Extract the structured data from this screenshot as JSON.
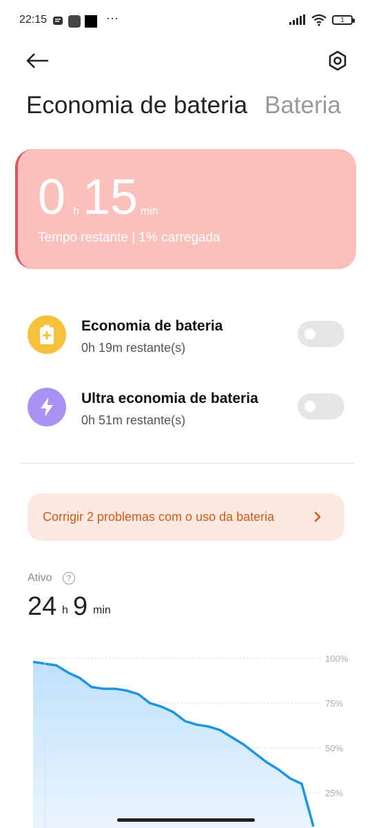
{
  "status_bar": {
    "time": "22:15",
    "battery_level": "1"
  },
  "header": {
    "tab_active": "Economia de bateria",
    "tab_inactive": "Bateria"
  },
  "card": {
    "hours": "0",
    "hours_unit": "h",
    "minutes": "15",
    "minutes_unit": "min",
    "subtitle": "Tempo restante | 1% carregada",
    "accent_color": "#fcc0bc"
  },
  "rows": [
    {
      "title": "Economia de bateria",
      "subtitle": "0h 19m restante(s)",
      "icon": "battery-plus-icon",
      "icon_color": "#f7c03d",
      "enabled": false
    },
    {
      "title": "Ultra economia de bateria",
      "subtitle": "0h 51m restante(s)",
      "icon": "lightning-icon",
      "icon_color": "#a893f5",
      "enabled": false
    }
  ],
  "banner": {
    "text": "Corrigir 2 problemas com o uso da bateria"
  },
  "active": {
    "label": "Ativo",
    "help": "?",
    "hours": "24",
    "hours_unit": "h",
    "minutes": "9",
    "minutes_unit": "min"
  },
  "chart_data": {
    "type": "area",
    "y_ticks": [
      "100%",
      "75%",
      "50%",
      "25%"
    ],
    "ylim": [
      0,
      100
    ],
    "x": [
      0,
      1,
      2,
      3,
      4,
      5,
      6,
      7,
      8,
      9,
      10,
      11,
      12,
      13,
      14,
      15,
      16,
      17,
      18,
      19,
      20,
      21,
      22,
      23,
      24
    ],
    "values": [
      98,
      97,
      96,
      92,
      89,
      84,
      83,
      83,
      82,
      80,
      75,
      73,
      70,
      65,
      63,
      62,
      60,
      56,
      52,
      47,
      42,
      38,
      33,
      30,
      0
    ]
  }
}
